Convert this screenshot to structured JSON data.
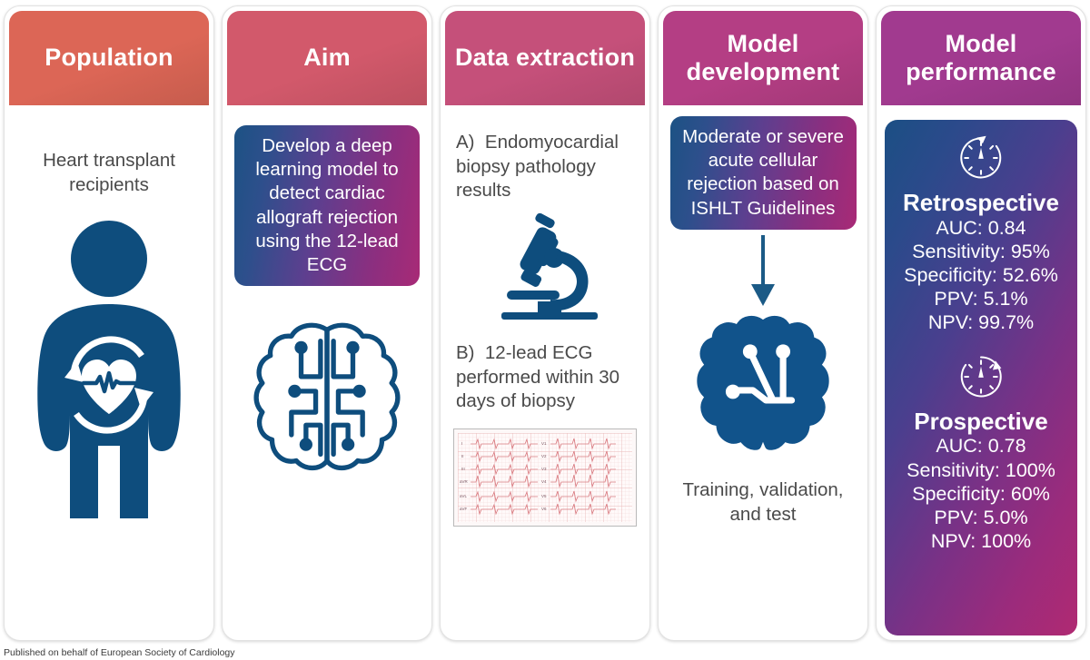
{
  "figure": {
    "footer": "Published on behalf of European Society of Cardiology"
  },
  "panels": [
    {
      "key": "population",
      "header": "Population",
      "header_color": "#DC6656",
      "text": "Heart transplant recipients",
      "icon": "person-with-heart-transplant-icon"
    },
    {
      "key": "aim",
      "header": "Aim",
      "header_color": "#D2596B",
      "callout": "Develop a deep learning model to detect cardiac allograft rejection using the 12-lead ECG",
      "icon": "ai-circuit-brain-icon"
    },
    {
      "key": "data_extraction",
      "header": "Data extraction",
      "header_color": "#C5507A",
      "item_a_label": "A)",
      "item_a": "Endomyocardial biopsy pathology results",
      "item_b_label": "B)",
      "item_b": "12-lead ECG performed within 30 days of biopsy",
      "icon_a": "microscope-icon",
      "icon_b": "twelve-lead-ecg-strip-image"
    },
    {
      "key": "model_development",
      "header": "Model development",
      "header_color": "#B43E84",
      "callout": "Moderate or severe acute cellular rejection based on ISHLT Guidelines",
      "arrow": "down-arrow-icon",
      "icon": "ai-brain-icon",
      "caption": "Training, validation, and test"
    },
    {
      "key": "model_performance",
      "header": "Model performance",
      "header_color": "#A13A8F",
      "results": [
        {
          "icon": "retrospective-clock-icon",
          "title": "Retrospective",
          "metrics": [
            "AUC: 0.84",
            "Sensitivity: 95%",
            "Specificity: 52.6%",
            "PPV: 5.1%",
            "NPV: 99.7%"
          ]
        },
        {
          "icon": "prospective-clock-icon",
          "title": "Prospective",
          "metrics": [
            "AUC: 0.78",
            "Sensitivity: 100%",
            "Specificity: 60%",
            "PPV: 5.0%",
            "NPV: 100%"
          ]
        }
      ]
    }
  ],
  "colors": {
    "icon_blue": "#0E4D7D",
    "gradient_start": "#1C5284",
    "gradient_end": "#AF2A73",
    "body_text": "#4A4A4A"
  }
}
